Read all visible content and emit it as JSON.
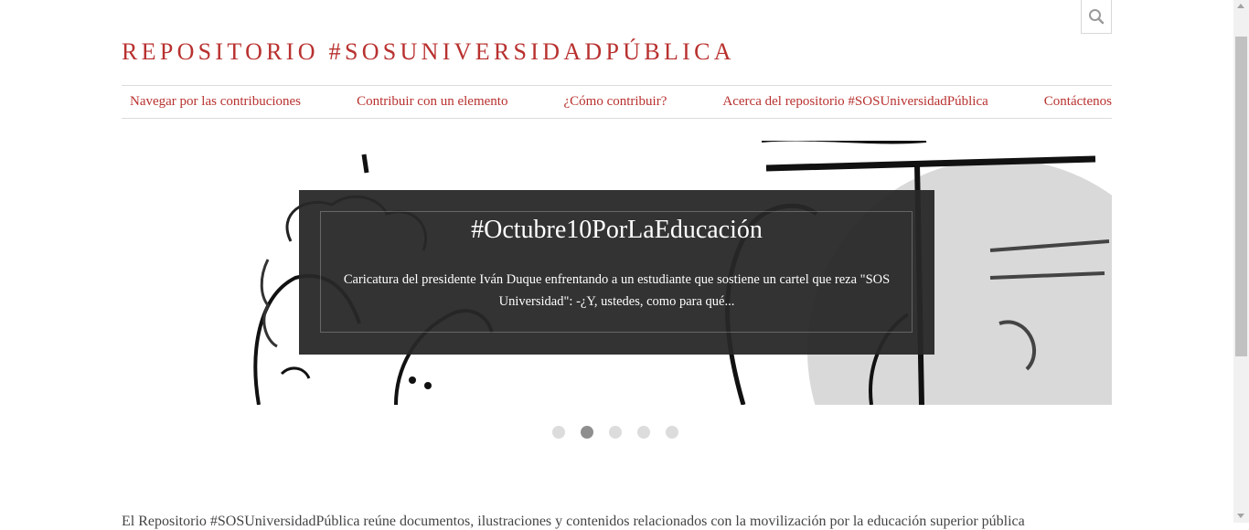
{
  "header": {
    "site_title": "REPOSITORIO #SOSUNIVERSIDADPÚBLICA",
    "search_icon": "search-icon"
  },
  "nav": {
    "items": [
      {
        "label": "Navegar por las contribuciones"
      },
      {
        "label": "Contribuir con un elemento"
      },
      {
        "label": "¿Cómo contribuir?"
      },
      {
        "label": "Acerca del repositorio #SOSUniversidadPública"
      },
      {
        "label": "Contáctenos"
      }
    ]
  },
  "slider": {
    "title": "#Octubre10PorLaEducación",
    "description": "Caricatura del presidente Iván Duque enfrentando a un estudiante que sostiene un cartel que reza \"SOS Universidad\": -¿Y, ustedes, como para qué...",
    "dot_count": 5,
    "active_dot": 2
  },
  "body": {
    "intro_text": "El Repositorio #SOSUniversidadPública reúne documentos, ilustraciones y contenidos relacionados con la movilización por la educación superior pública"
  },
  "colors": {
    "accent": "#b8312f",
    "caption_bg": "#282828"
  }
}
